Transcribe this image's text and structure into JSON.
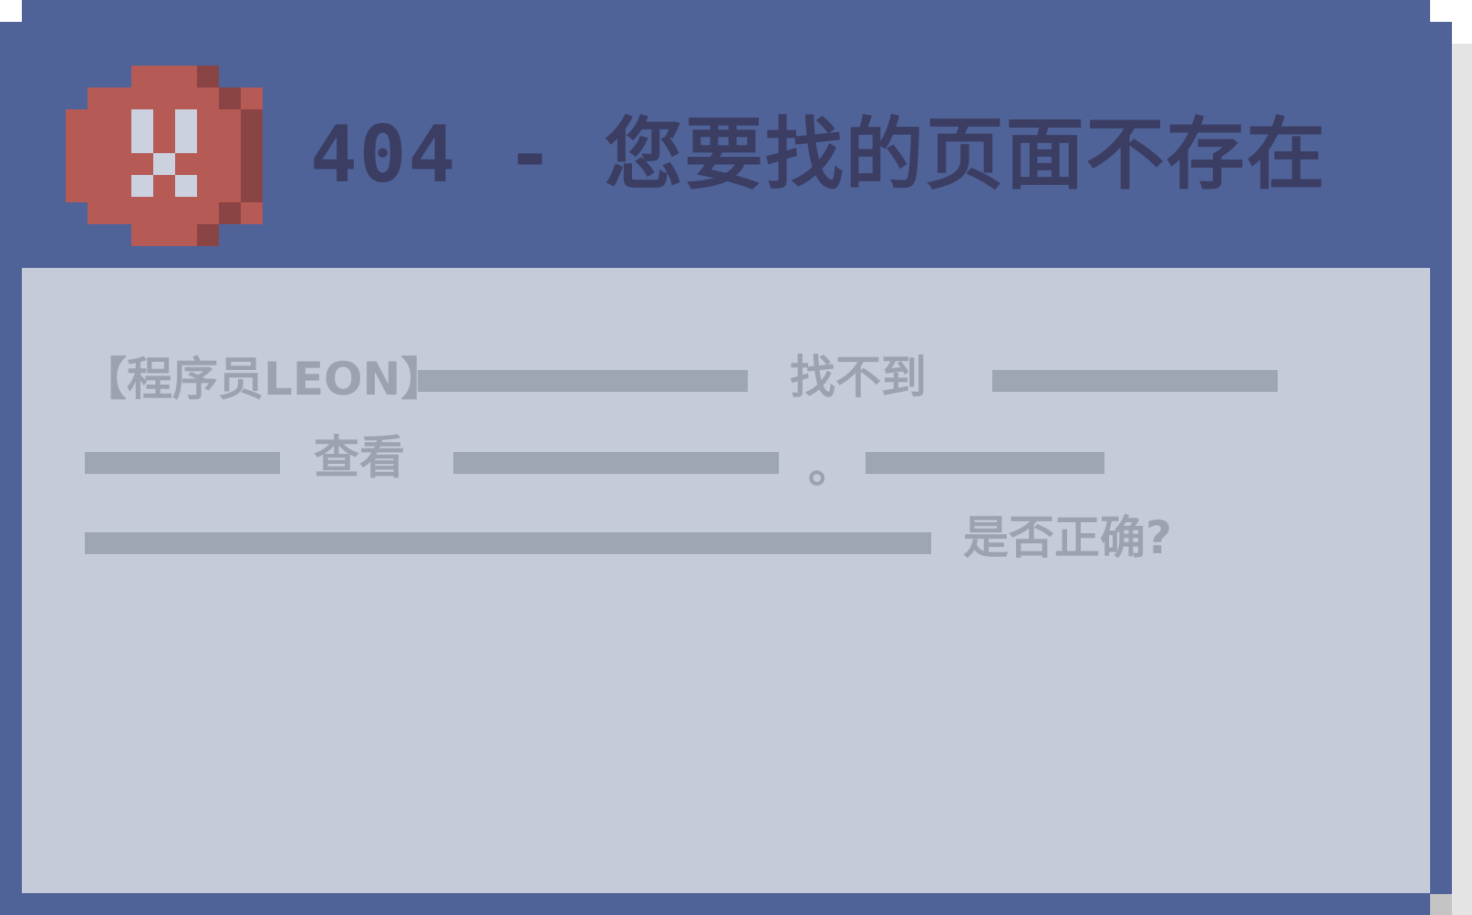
{
  "dialog": {
    "title": "404 - 您要找的页面不存在",
    "icon": "error-x-icon",
    "colors": {
      "frame": "#4f6399",
      "panel": "#c5cbd9",
      "title_text": "#3b3d62",
      "icon_red": "#b55a54",
      "icon_shadow": "#8a4444",
      "message_text": "#9ca2ae",
      "redaction_bar": "#9fa6b3"
    }
  },
  "message": {
    "speaker": "【程序员LEON】",
    "word_not_found": "找不到",
    "word_view": "查看",
    "period": "。",
    "word_correct": "是否正确?"
  }
}
